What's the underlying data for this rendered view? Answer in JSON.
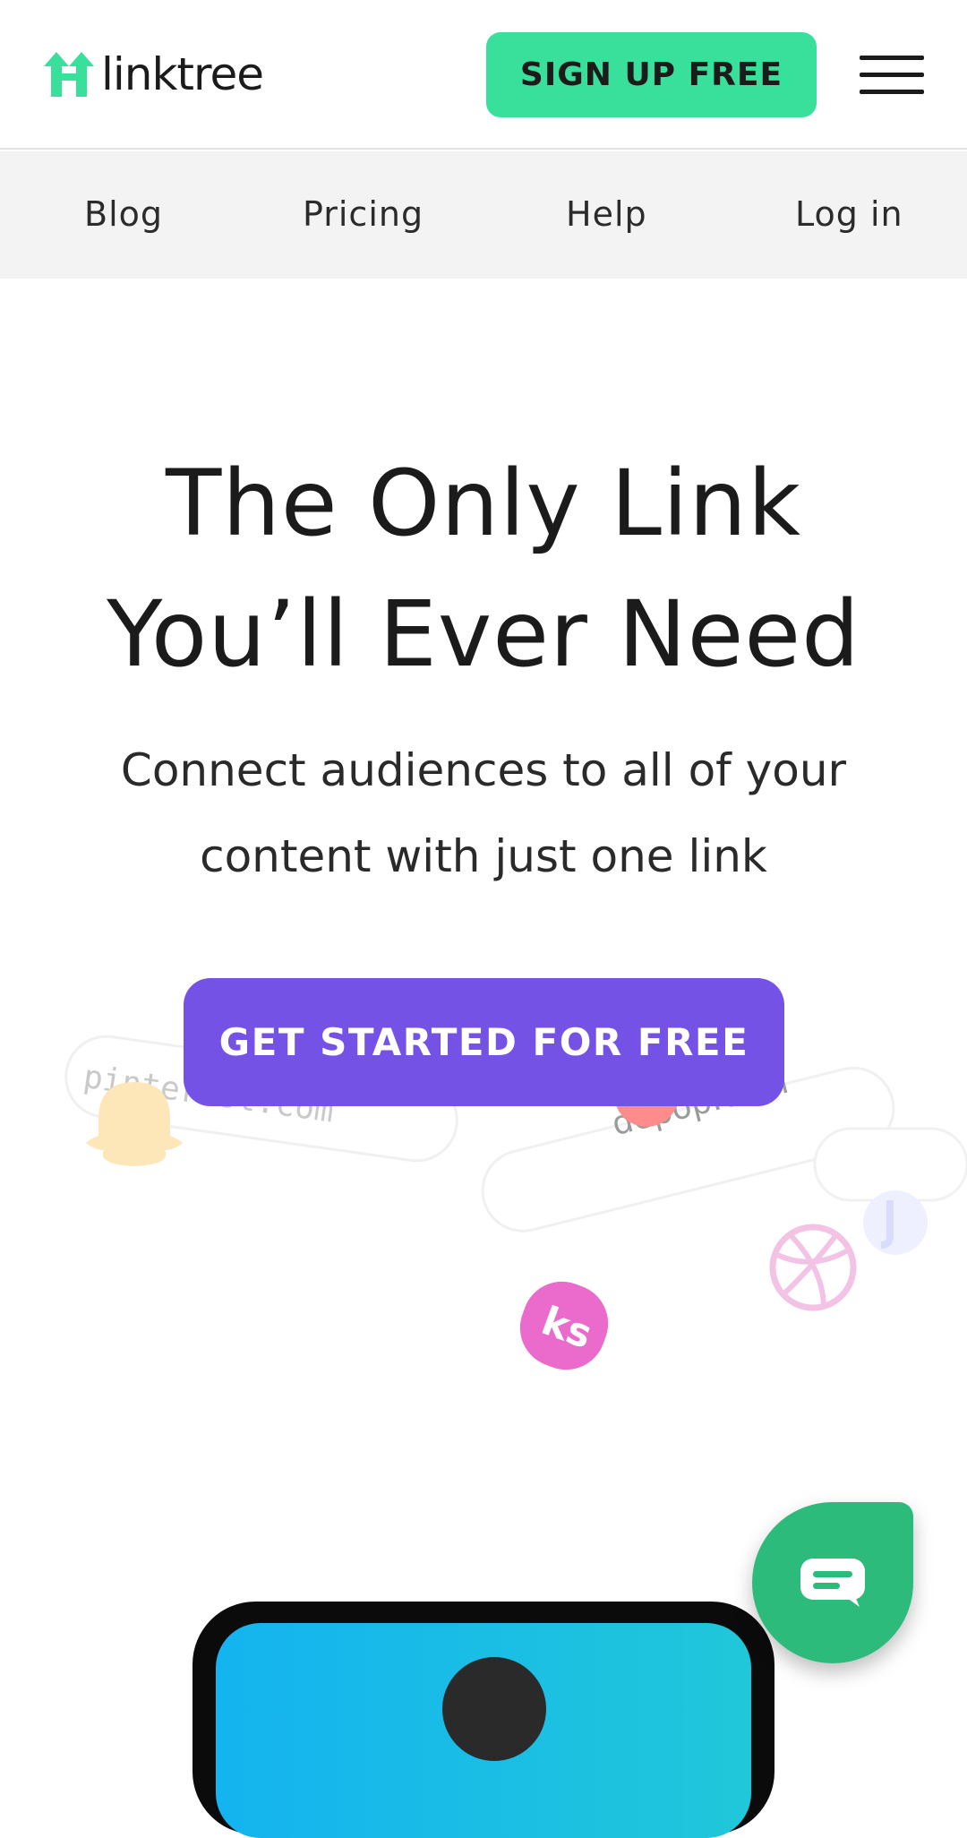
{
  "header": {
    "logo_text": "linktree",
    "signup_label": "SIGN UP FREE"
  },
  "nav": {
    "items": [
      "Blog",
      "Pricing",
      "Help",
      "Log in"
    ]
  },
  "hero": {
    "title_line1": "The Only Link",
    "title_line2": "You’ll Ever Need",
    "subtitle_line1": "Connect audiences to all of your",
    "subtitle_line2": "content with just one link",
    "cta_label": "GET STARTED FOR FREE"
  },
  "decor": {
    "pill_left_text": "pinterest.com",
    "pill_right_text": "depop.com",
    "icons": [
      "snapchat-icon",
      "dribbble-icon",
      "kofi-icon",
      "tiktok-icon"
    ]
  },
  "colors": {
    "brand_green": "#39e09b",
    "cta_purple": "#7452e6",
    "chat_green": "#2dbb7c",
    "subnav_bg": "#f3f3f3"
  }
}
